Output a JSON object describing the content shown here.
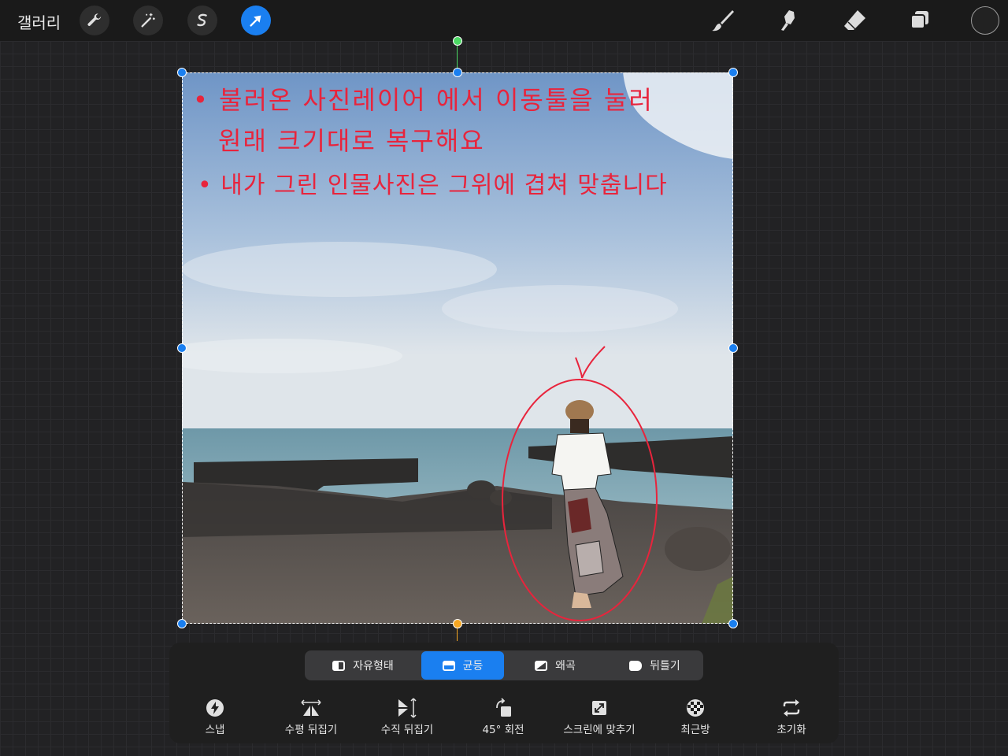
{
  "topbar": {
    "gallery_label": "갤러리",
    "left_tools": [
      "wrench-icon",
      "magic-wand-icon",
      "selection-icon",
      "transform-arrow-icon"
    ],
    "active_tool": "transform-arrow-icon",
    "right_tools": [
      "brush-icon",
      "smudge-icon",
      "eraser-icon",
      "layers-icon"
    ],
    "color": "#222222"
  },
  "canvas": {
    "annotation_lines": [
      "• 불러온 사진레이어 에서   이동툴을 눌러",
      "원래 크기대로 복구해요",
      "• 내가 그린 인물사진은 그위에 겹쳐  맞춥니다"
    ],
    "annotation_color": "#e8243c"
  },
  "transform": {
    "modes": [
      {
        "label": "자유형태",
        "icon": "freeform-icon"
      },
      {
        "label": "균등",
        "icon": "uniform-icon"
      },
      {
        "label": "왜곡",
        "icon": "distort-icon"
      },
      {
        "label": "뒤틀기",
        "icon": "warp-icon"
      }
    ],
    "active_mode": "균등",
    "actions": [
      {
        "label": "스냅",
        "icon": "snap-icon"
      },
      {
        "label": "수평 뒤집기",
        "icon": "flip-horizontal-icon"
      },
      {
        "label": "수직 뒤집기",
        "icon": "flip-vertical-icon"
      },
      {
        "label": "45° 회전",
        "icon": "rotate-45-icon"
      },
      {
        "label": "스크린에 맞추기",
        "icon": "fit-screen-icon"
      },
      {
        "label": "최근방",
        "icon": "interpolation-icon"
      },
      {
        "label": "초기화",
        "icon": "reset-icon"
      }
    ]
  },
  "colors": {
    "accent": "#1a7ff0",
    "handle_top": "#4cd964",
    "handle_bottom": "#f5a623"
  }
}
